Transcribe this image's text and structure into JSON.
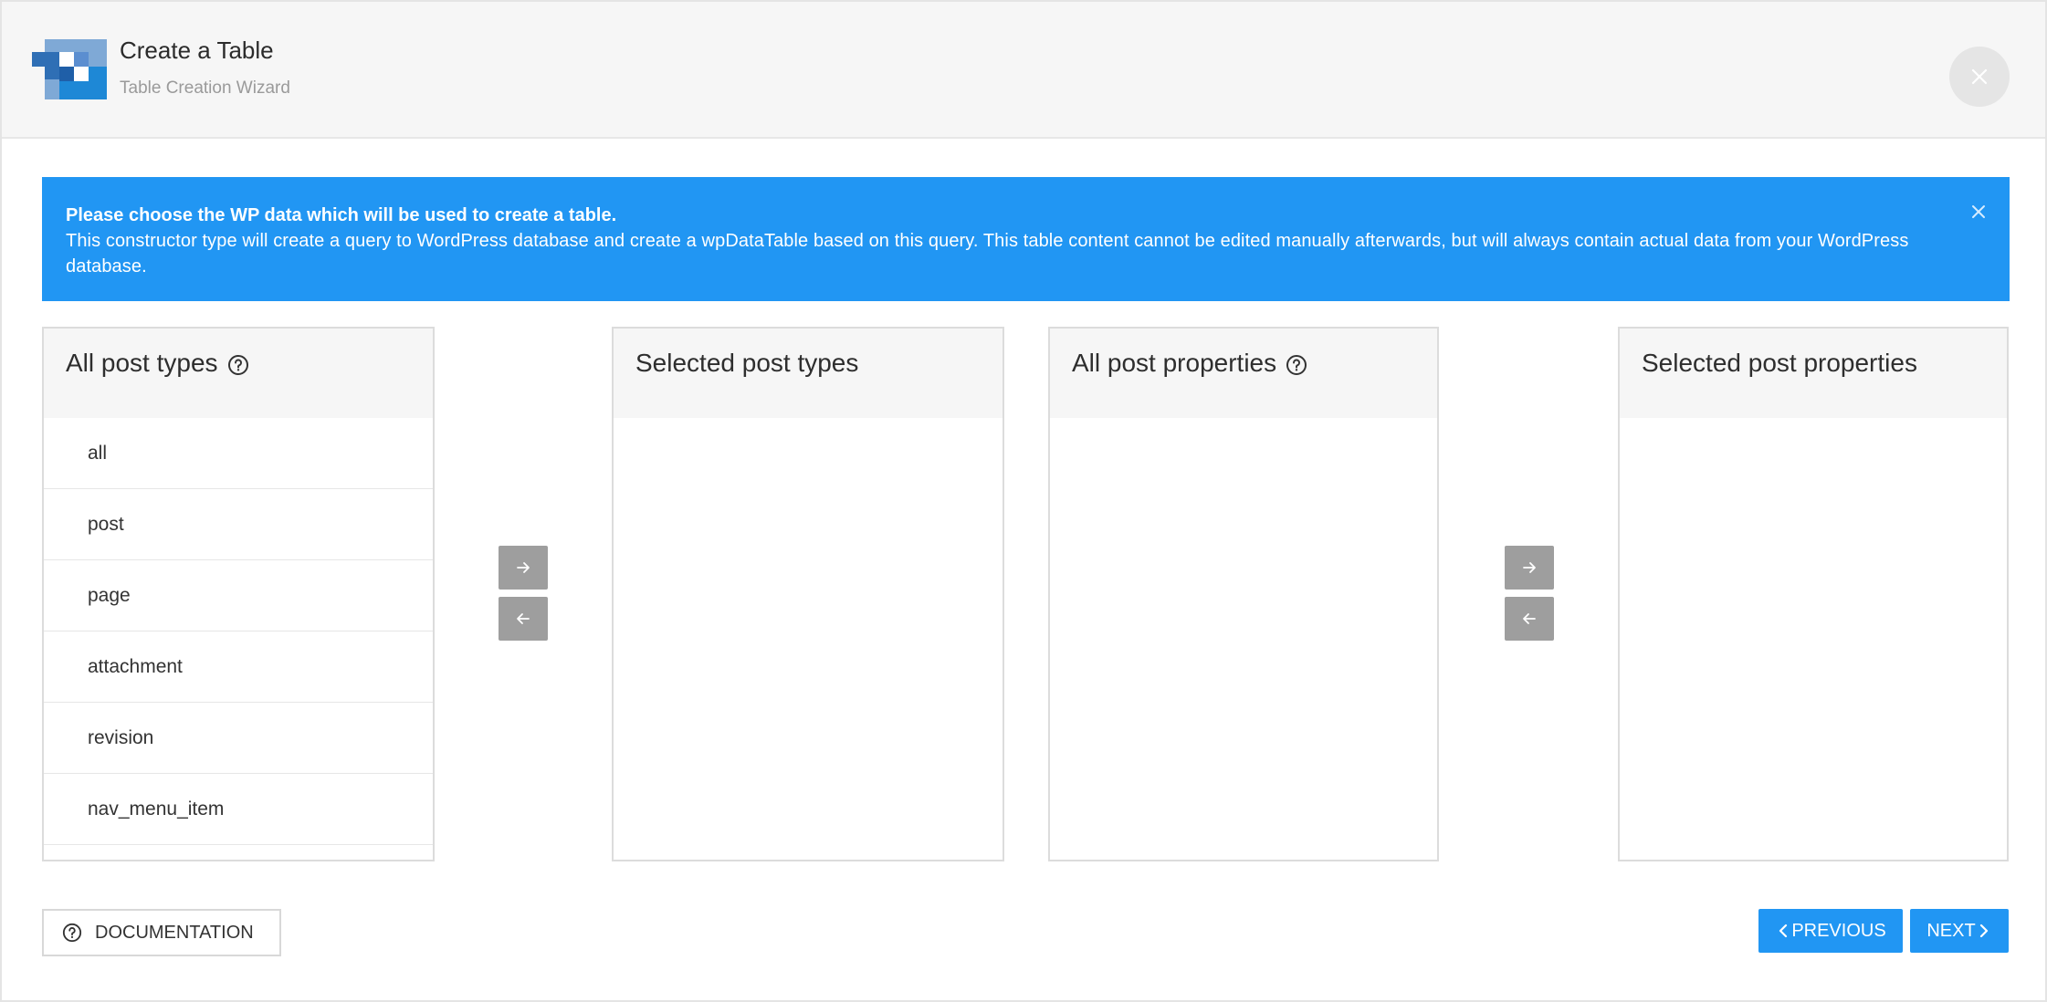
{
  "header": {
    "title": "Create a Table",
    "subtitle": "Table Creation Wizard"
  },
  "alert": {
    "title": "Please choose the WP data which will be used to create a table.",
    "text": "This constructor type will create a query to WordPress database and create a wpDataTable based on this query. This table content cannot be edited manually afterwards, but will always contain actual data from your WordPress database."
  },
  "panels": {
    "all_post_types": {
      "title": "All post types",
      "items": [
        "all",
        "post",
        "page",
        "attachment",
        "revision",
        "nav_menu_item"
      ]
    },
    "selected_post_types": {
      "title": "Selected post types"
    },
    "all_post_properties": {
      "title": "All post properties"
    },
    "selected_post_properties": {
      "title": "Selected post properties"
    }
  },
  "footer": {
    "documentation_label": "DOCUMENTATION",
    "previous_label": "PREVIOUS",
    "next_label": "NEXT"
  },
  "colors": {
    "accent": "#2196f3",
    "arrow_button": "#9e9e9e",
    "header_bg": "#f6f6f6"
  },
  "icons": [
    "table-logo-icon",
    "close-icon",
    "help-icon",
    "arrow-right-icon",
    "arrow-left-icon",
    "chevron-left-icon",
    "chevron-right-icon"
  ]
}
